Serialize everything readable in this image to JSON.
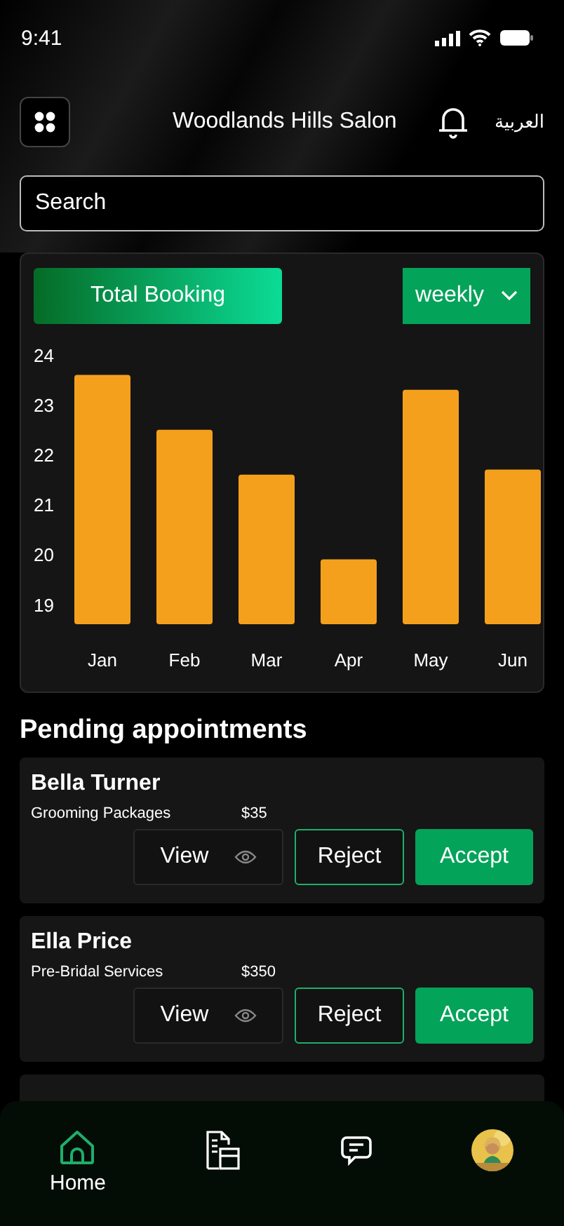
{
  "status_bar": {
    "time": "9:41"
  },
  "header": {
    "title": "Woodlands Hills Salon",
    "language": "العربية"
  },
  "search": {
    "placeholder": "Search"
  },
  "booking_panel": {
    "title": "Total Booking",
    "period": "weekly",
    "chart_data": {
      "type": "bar",
      "categories": [
        "Jan",
        "Feb",
        "Mar",
        "Apr",
        "May",
        "Jun"
      ],
      "series": [
        {
          "color": "#f5a01d",
          "values": [
            23.6,
            22.5,
            21.6,
            19.9,
            23.3,
            21.7
          ]
        }
      ],
      "ylim": [
        18.6,
        24
      ],
      "yticks": [
        19,
        20,
        21,
        22,
        23,
        24
      ]
    }
  },
  "pending": {
    "title": "Pending appointments",
    "appointments": [
      {
        "name": "Bella Turner",
        "service": "Grooming Packages",
        "price": "$35",
        "actions": [
          {
            "kind": "view",
            "label": "View"
          },
          {
            "kind": "reject",
            "label": "Reject"
          },
          {
            "kind": "accept",
            "label": "Accept"
          }
        ]
      },
      {
        "name": "Ella Price",
        "service": "Pre-Bridal Services",
        "price": "$350",
        "actions": [
          {
            "kind": "view",
            "label": "View"
          },
          {
            "kind": "reject",
            "label": "Reject"
          },
          {
            "kind": "accept",
            "label": "Accept"
          }
        ]
      }
    ]
  },
  "nav": [
    {
      "kind": "home",
      "label": "Home",
      "selected": true
    },
    {
      "kind": "schedule",
      "selected": false
    },
    {
      "kind": "chat",
      "selected": false
    },
    {
      "kind": "avatar",
      "selected": false
    }
  ]
}
